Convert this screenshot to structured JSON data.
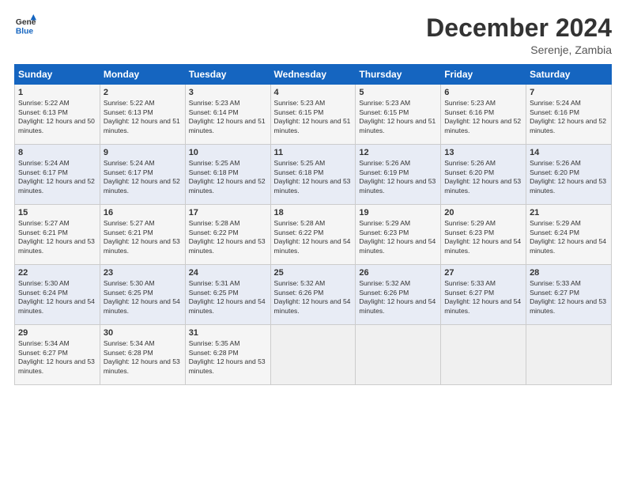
{
  "logo": {
    "line1": "General",
    "line2": "Blue"
  },
  "title": "December 2024",
  "location": "Serenje, Zambia",
  "days_of_week": [
    "Sunday",
    "Monday",
    "Tuesday",
    "Wednesday",
    "Thursday",
    "Friday",
    "Saturday"
  ],
  "weeks": [
    [
      {
        "day": "1",
        "sunrise": "Sunrise: 5:22 AM",
        "sunset": "Sunset: 6:13 PM",
        "daylight": "Daylight: 12 hours and 50 minutes."
      },
      {
        "day": "2",
        "sunrise": "Sunrise: 5:22 AM",
        "sunset": "Sunset: 6:13 PM",
        "daylight": "Daylight: 12 hours and 51 minutes."
      },
      {
        "day": "3",
        "sunrise": "Sunrise: 5:23 AM",
        "sunset": "Sunset: 6:14 PM",
        "daylight": "Daylight: 12 hours and 51 minutes."
      },
      {
        "day": "4",
        "sunrise": "Sunrise: 5:23 AM",
        "sunset": "Sunset: 6:15 PM",
        "daylight": "Daylight: 12 hours and 51 minutes."
      },
      {
        "day": "5",
        "sunrise": "Sunrise: 5:23 AM",
        "sunset": "Sunset: 6:15 PM",
        "daylight": "Daylight: 12 hours and 51 minutes."
      },
      {
        "day": "6",
        "sunrise": "Sunrise: 5:23 AM",
        "sunset": "Sunset: 6:16 PM",
        "daylight": "Daylight: 12 hours and 52 minutes."
      },
      {
        "day": "7",
        "sunrise": "Sunrise: 5:24 AM",
        "sunset": "Sunset: 6:16 PM",
        "daylight": "Daylight: 12 hours and 52 minutes."
      }
    ],
    [
      {
        "day": "8",
        "sunrise": "Sunrise: 5:24 AM",
        "sunset": "Sunset: 6:17 PM",
        "daylight": "Daylight: 12 hours and 52 minutes."
      },
      {
        "day": "9",
        "sunrise": "Sunrise: 5:24 AM",
        "sunset": "Sunset: 6:17 PM",
        "daylight": "Daylight: 12 hours and 52 minutes."
      },
      {
        "day": "10",
        "sunrise": "Sunrise: 5:25 AM",
        "sunset": "Sunset: 6:18 PM",
        "daylight": "Daylight: 12 hours and 52 minutes."
      },
      {
        "day": "11",
        "sunrise": "Sunrise: 5:25 AM",
        "sunset": "Sunset: 6:18 PM",
        "daylight": "Daylight: 12 hours and 53 minutes."
      },
      {
        "day": "12",
        "sunrise": "Sunrise: 5:26 AM",
        "sunset": "Sunset: 6:19 PM",
        "daylight": "Daylight: 12 hours and 53 minutes."
      },
      {
        "day": "13",
        "sunrise": "Sunrise: 5:26 AM",
        "sunset": "Sunset: 6:20 PM",
        "daylight": "Daylight: 12 hours and 53 minutes."
      },
      {
        "day": "14",
        "sunrise": "Sunrise: 5:26 AM",
        "sunset": "Sunset: 6:20 PM",
        "daylight": "Daylight: 12 hours and 53 minutes."
      }
    ],
    [
      {
        "day": "15",
        "sunrise": "Sunrise: 5:27 AM",
        "sunset": "Sunset: 6:21 PM",
        "daylight": "Daylight: 12 hours and 53 minutes."
      },
      {
        "day": "16",
        "sunrise": "Sunrise: 5:27 AM",
        "sunset": "Sunset: 6:21 PM",
        "daylight": "Daylight: 12 hours and 53 minutes."
      },
      {
        "day": "17",
        "sunrise": "Sunrise: 5:28 AM",
        "sunset": "Sunset: 6:22 PM",
        "daylight": "Daylight: 12 hours and 53 minutes."
      },
      {
        "day": "18",
        "sunrise": "Sunrise: 5:28 AM",
        "sunset": "Sunset: 6:22 PM",
        "daylight": "Daylight: 12 hours and 54 minutes."
      },
      {
        "day": "19",
        "sunrise": "Sunrise: 5:29 AM",
        "sunset": "Sunset: 6:23 PM",
        "daylight": "Daylight: 12 hours and 54 minutes."
      },
      {
        "day": "20",
        "sunrise": "Sunrise: 5:29 AM",
        "sunset": "Sunset: 6:23 PM",
        "daylight": "Daylight: 12 hours and 54 minutes."
      },
      {
        "day": "21",
        "sunrise": "Sunrise: 5:29 AM",
        "sunset": "Sunset: 6:24 PM",
        "daylight": "Daylight: 12 hours and 54 minutes."
      }
    ],
    [
      {
        "day": "22",
        "sunrise": "Sunrise: 5:30 AM",
        "sunset": "Sunset: 6:24 PM",
        "daylight": "Daylight: 12 hours and 54 minutes."
      },
      {
        "day": "23",
        "sunrise": "Sunrise: 5:30 AM",
        "sunset": "Sunset: 6:25 PM",
        "daylight": "Daylight: 12 hours and 54 minutes."
      },
      {
        "day": "24",
        "sunrise": "Sunrise: 5:31 AM",
        "sunset": "Sunset: 6:25 PM",
        "daylight": "Daylight: 12 hours and 54 minutes."
      },
      {
        "day": "25",
        "sunrise": "Sunrise: 5:32 AM",
        "sunset": "Sunset: 6:26 PM",
        "daylight": "Daylight: 12 hours and 54 minutes."
      },
      {
        "day": "26",
        "sunrise": "Sunrise: 5:32 AM",
        "sunset": "Sunset: 6:26 PM",
        "daylight": "Daylight: 12 hours and 54 minutes."
      },
      {
        "day": "27",
        "sunrise": "Sunrise: 5:33 AM",
        "sunset": "Sunset: 6:27 PM",
        "daylight": "Daylight: 12 hours and 54 minutes."
      },
      {
        "day": "28",
        "sunrise": "Sunrise: 5:33 AM",
        "sunset": "Sunset: 6:27 PM",
        "daylight": "Daylight: 12 hours and 53 minutes."
      }
    ],
    [
      {
        "day": "29",
        "sunrise": "Sunrise: 5:34 AM",
        "sunset": "Sunset: 6:27 PM",
        "daylight": "Daylight: 12 hours and 53 minutes."
      },
      {
        "day": "30",
        "sunrise": "Sunrise: 5:34 AM",
        "sunset": "Sunset: 6:28 PM",
        "daylight": "Daylight: 12 hours and 53 minutes."
      },
      {
        "day": "31",
        "sunrise": "Sunrise: 5:35 AM",
        "sunset": "Sunset: 6:28 PM",
        "daylight": "Daylight: 12 hours and 53 minutes."
      },
      null,
      null,
      null,
      null
    ]
  ]
}
